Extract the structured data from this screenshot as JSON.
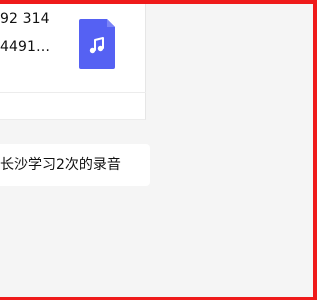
{
  "file_card": {
    "line1": "92 314",
    "line2": "4491…",
    "icon": "music-file-icon"
  },
  "message": {
    "text": "长沙学习2次的录音"
  },
  "theme": {
    "frame_color": "#ef1a1a",
    "icon_color": "#5561f3",
    "background": "#f5f5f5"
  }
}
